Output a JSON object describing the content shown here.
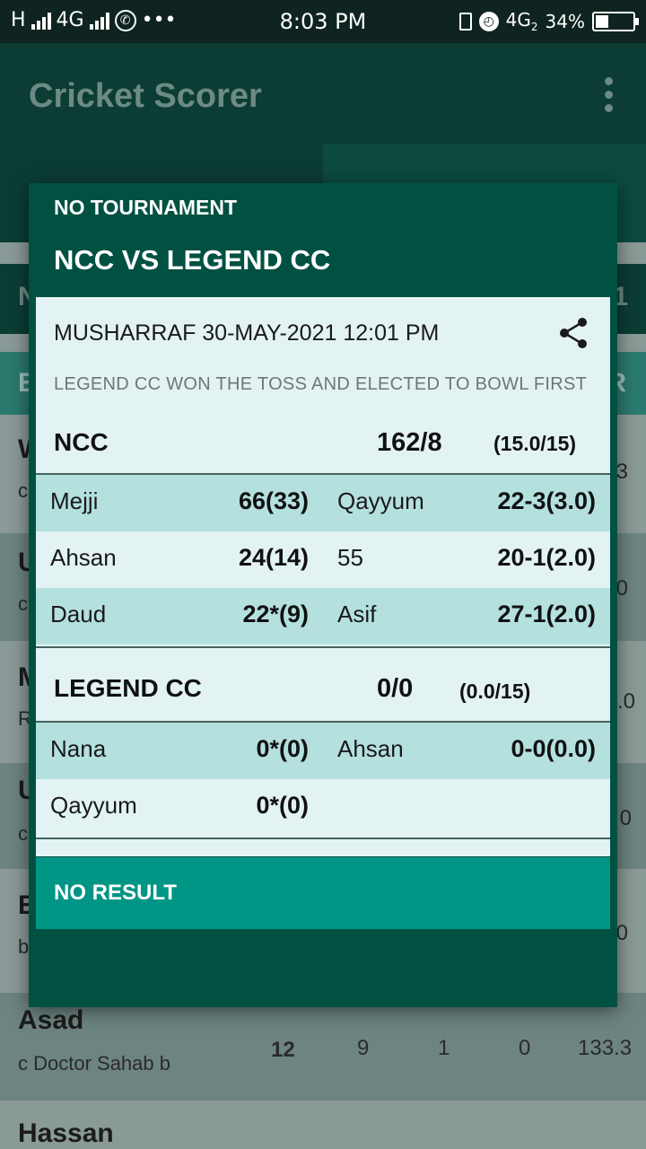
{
  "status_bar": {
    "network_h": "H",
    "network_4g": "4G",
    "more": "•••",
    "time": "8:03 PM",
    "network_4g2": "4G",
    "network_4g2_sub": "2",
    "battery_text": "34%",
    "battery_level": 0.34
  },
  "app": {
    "title": "Cricket Scorer"
  },
  "background": {
    "edge_right": [
      "1",
      "R",
      "3",
      "0",
      ".0",
      "0",
      "0"
    ],
    "edge_left": [
      "N",
      "E",
      "W",
      "c",
      "U",
      "c",
      "M",
      "R",
      "U",
      "c",
      "E",
      "b"
    ],
    "row_asad": {
      "name": "Asad",
      "dismissal": "c Doctor Sahab b",
      "runs": "12",
      "balls": "9",
      "fours": "1",
      "sixes": "0",
      "strike_rate": "133.3"
    },
    "row_hassan": {
      "name": "Hassan"
    }
  },
  "dialog": {
    "tournament": "NO TOURNAMENT",
    "match": "NCC VS LEGEND CC",
    "meta": "MUSHARRAF  30-MAY-2021 12:01 PM",
    "toss": "LEGEND CC WON THE TOSS AND ELECTED TO BOWL FIRST",
    "team1": {
      "name": "NCC",
      "score": "162/8",
      "overs": "(15.0/15)",
      "rows": [
        {
          "batsman": "Mejji",
          "bat_score": "66(33)",
          "bowler": "Qayyum",
          "bowl_figures": "22-3(3.0)"
        },
        {
          "batsman": "Ahsan",
          "bat_score": "24(14)",
          "bowler": "55",
          "bowl_figures": "20-1(2.0)"
        },
        {
          "batsman": "Daud",
          "bat_score": "22*(9)",
          "bowler": "Asif",
          "bowl_figures": "27-1(2.0)"
        }
      ]
    },
    "team2": {
      "name": "LEGEND CC",
      "score": "0/0",
      "overs": "(0.0/15)",
      "rows": [
        {
          "batsman": "Nana",
          "bat_score": "0*(0)",
          "bowler": "Ahsan",
          "bowl_figures": "0-0(0.0)"
        },
        {
          "batsman": "Qayyum",
          "bat_score": "0*(0)",
          "bowler": "",
          "bowl_figures": ""
        }
      ]
    },
    "result": "NO RESULT"
  },
  "colors": {
    "app_bar": "#0b3d34",
    "dialog": "#005142",
    "card": "#e3f3f3",
    "row_highlight": "#b4e0de",
    "result_bar": "#009585"
  }
}
